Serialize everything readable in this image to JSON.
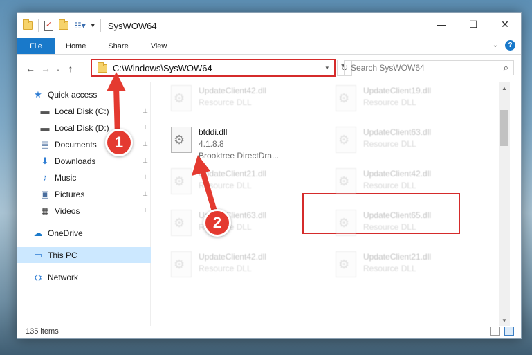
{
  "window": {
    "title": "SysWOW64",
    "controls": {
      "minimize": "—",
      "maximize": "☐",
      "close": "✕"
    }
  },
  "ribbon": {
    "tabs": [
      "File",
      "Home",
      "Share",
      "View"
    ],
    "help": "?"
  },
  "navigation": {
    "back": "←",
    "forward": "→",
    "recent": "⌄",
    "up": "↑",
    "address": "C:\\Windows\\SysWOW64",
    "refresh": "↻",
    "search_placeholder": "Search SysWOW64"
  },
  "sidebar": {
    "items": [
      {
        "label": "Quick access",
        "icon": "star-icon",
        "glyph": "★",
        "color": "#2f7dd3",
        "pinned": false
      },
      {
        "label": "Local Disk (C:)",
        "icon": "drive-icon",
        "glyph": "▬",
        "color": "#555555",
        "pinned": true
      },
      {
        "label": "Local Disk (D:)",
        "icon": "drive-icon",
        "glyph": "▬",
        "color": "#555555",
        "pinned": true
      },
      {
        "label": "Documents",
        "icon": "documents-icon",
        "glyph": "▤",
        "color": "#4a6e9e",
        "pinned": true
      },
      {
        "label": "Downloads",
        "icon": "downloads-icon",
        "glyph": "⬇",
        "color": "#2f7dd3",
        "pinned": true
      },
      {
        "label": "Music",
        "icon": "music-icon",
        "glyph": "♪",
        "color": "#2f7dd3",
        "pinned": true
      },
      {
        "label": "Pictures",
        "icon": "pictures-icon",
        "glyph": "▣",
        "color": "#4a6e9e",
        "pinned": true
      },
      {
        "label": "Videos",
        "icon": "videos-icon",
        "glyph": "▦",
        "color": "#3a3a3a",
        "pinned": true
      },
      {
        "label": "OneDrive",
        "icon": "onedrive-icon",
        "glyph": "☁",
        "color": "#1979ca",
        "pinned": false
      },
      {
        "label": "This PC",
        "icon": "computer-icon",
        "glyph": "▭",
        "color": "#2f7dd3",
        "pinned": false,
        "selected": true
      },
      {
        "label": "Network",
        "icon": "network-icon",
        "glyph": "⛭",
        "color": "#2f7dd3",
        "pinned": false
      }
    ],
    "pin_glyph": "📌"
  },
  "files": [
    {
      "name": "UpdateClient42.dll",
      "sub": "Resource DLL",
      "faded": true
    },
    {
      "name": "UpdateClient19.dll",
      "sub": "Resource DLL",
      "faded": true
    },
    {
      "name": "btddi.dll",
      "version": "4.1.8.8",
      "sub": "Brooktree DirectDra...",
      "faded": false
    },
    {
      "name": "UpdateClient63.dll",
      "sub": "Resource DLL",
      "faded": true
    },
    {
      "name": "UpdateClient21.dll",
      "sub": "Resource DLL",
      "faded": true
    },
    {
      "name": "UpdateClient42.dll",
      "sub": "Resource DLL",
      "faded": true
    },
    {
      "name": "UpdateClient63.dll",
      "sub": "Resource DLL",
      "faded": true
    },
    {
      "name": "UpdateClient65.dll",
      "sub": "Resource DLL",
      "faded": true
    },
    {
      "name": "UpdateClient42.dll",
      "sub": "Resource DLL",
      "faded": true
    },
    {
      "name": "UpdateClient21.dll",
      "sub": "Resource DLL",
      "faded": true
    }
  ],
  "status": {
    "item_count": "135 items"
  },
  "annotations": {
    "step1": "1",
    "step2": "2",
    "color": "#e43a30"
  }
}
